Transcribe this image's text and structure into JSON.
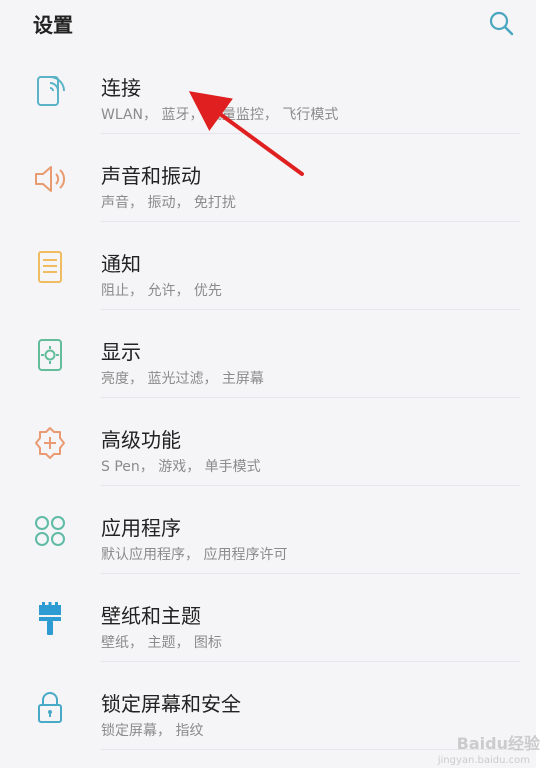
{
  "header": {
    "title": "设置",
    "search_icon": "search-icon"
  },
  "items": [
    {
      "icon": "connection-icon",
      "color": "#5bb3c8",
      "label": "连接",
      "sub": "WLAN， 蓝牙， 流量监控， 飞行模式"
    },
    {
      "icon": "speaker-icon",
      "color": "#e79b6f",
      "label": "声音和振动",
      "sub": "声音， 振动， 免打扰"
    },
    {
      "icon": "notification-icon",
      "color": "#efbc62",
      "label": "通知",
      "sub": "阻止， 允许， 优先"
    },
    {
      "icon": "display-icon",
      "color": "#63bd9b",
      "label": "显示",
      "sub": "亮度， 蓝光过滤， 主屏幕"
    },
    {
      "icon": "advanced-features-icon",
      "color": "#ea9a73",
      "label": "高级功能",
      "sub": "S Pen， 游戏， 单手模式"
    },
    {
      "icon": "apps-icon",
      "color": "#5fbba6",
      "label": "应用程序",
      "sub": "默认应用程序， 应用程序许可"
    },
    {
      "icon": "brush-icon",
      "color": "#2f9bd3",
      "label": "壁纸和主题",
      "sub": "壁纸， 主题， 图标"
    },
    {
      "icon": "lock-icon",
      "color": "#49aac8",
      "label": "锁定屏幕和安全",
      "sub": "锁定屏幕， 指纹"
    }
  ],
  "annotation": {
    "arrow_color": "#e02020"
  },
  "watermark": {
    "brand": "Baidu经验",
    "url": "jingyan.baidu.com"
  }
}
